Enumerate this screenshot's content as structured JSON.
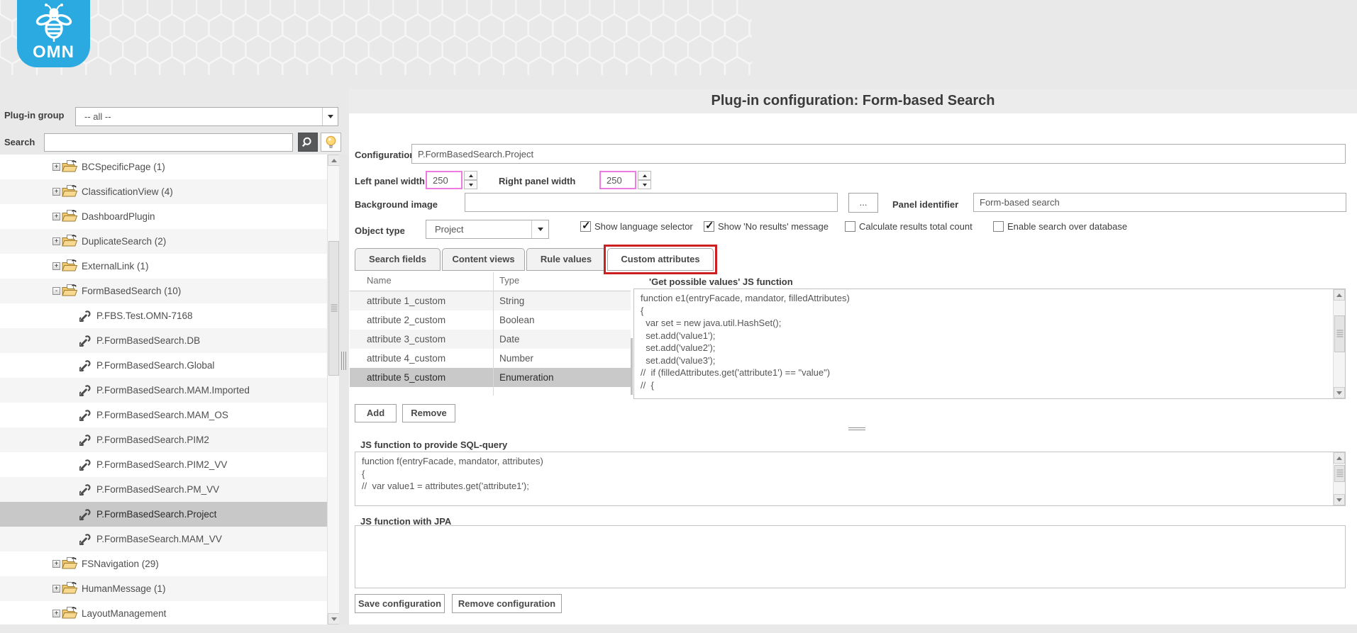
{
  "logo": {
    "text": "OMN"
  },
  "colors": {
    "brand_blue": "#2BA9E1",
    "selection_gray": "#C8C8C8",
    "field_highlight_pink": "#F07BE0",
    "annotation_red": "#CC2020",
    "search_button_gray": "#57585A"
  },
  "icons": {
    "logo": "bee-icon",
    "search_button": "magnifier-icon",
    "hint_button": "lightbulb-icon",
    "tree_group": "open-folder-icon",
    "tree_config": "wrench-icon"
  },
  "sidebar": {
    "plugin_group_label": "Plug-in group",
    "plugin_group_value": "-- all --",
    "search_label": "Search",
    "search_value": "",
    "tree": [
      {
        "label": "BCSpecificPage (1)",
        "kind": "group"
      },
      {
        "label": "ClassificationView (4)",
        "kind": "group"
      },
      {
        "label": "DashboardPlugin",
        "kind": "group"
      },
      {
        "label": "DuplicateSearch (2)",
        "kind": "group"
      },
      {
        "label": "ExternalLink (1)",
        "kind": "group"
      },
      {
        "label": "FormBasedSearch (10)",
        "kind": "group",
        "expanded": true
      },
      {
        "label": "P.FBS.Test.OMN-7168",
        "kind": "config"
      },
      {
        "label": "P.FormBasedSearch.DB",
        "kind": "config"
      },
      {
        "label": "P.FormBasedSearch.Global",
        "kind": "config"
      },
      {
        "label": "P.FormBasedSearch.MAM.Imported",
        "kind": "config"
      },
      {
        "label": "P.FormBasedSearch.MAM_OS",
        "kind": "config"
      },
      {
        "label": "P.FormBasedSearch.PIM2",
        "kind": "config"
      },
      {
        "label": "P.FormBasedSearch.PIM2_VV",
        "kind": "config"
      },
      {
        "label": "P.FormBasedSearch.PM_VV",
        "kind": "config"
      },
      {
        "label": "P.FormBasedSearch.Project",
        "kind": "config",
        "selected": true
      },
      {
        "label": "P.FormBaseSearch.MAM_VV",
        "kind": "config"
      },
      {
        "label": "FSNavigation (29)",
        "kind": "group"
      },
      {
        "label": "HumanMessage (1)",
        "kind": "group"
      },
      {
        "label": "LayoutManagement",
        "kind": "group"
      }
    ]
  },
  "header": {
    "title": "Plug-in configuration: Form-based Search"
  },
  "form": {
    "config_identifier": {
      "label": "Configuration identifier",
      "value": "P.FormBasedSearch.Project"
    },
    "left_panel_width": {
      "label": "Left panel width",
      "value": "250"
    },
    "right_panel_width": {
      "label": "Right panel width",
      "value": "250"
    },
    "background_image": {
      "label": "Background image",
      "value": ""
    },
    "browse_button": "...",
    "panel_identifier": {
      "label": "Panel identifier",
      "value": "Form-based search"
    },
    "object_type": {
      "label": "Object type",
      "value": "Project"
    },
    "checkboxes": [
      {
        "label": "Show language selector",
        "checked": true
      },
      {
        "label": "Show 'No results' message",
        "checked": true
      },
      {
        "label": "Calculate results total count",
        "checked": false
      },
      {
        "label": "Enable search over database",
        "checked": false
      }
    ]
  },
  "tabs": [
    {
      "label": "Search fields"
    },
    {
      "label": "Content views"
    },
    {
      "label": "Rule values"
    },
    {
      "label": "Custom attributes",
      "active": true,
      "annotated": true
    }
  ],
  "attributes_table": {
    "columns": [
      "Name",
      "Type"
    ],
    "rows": [
      {
        "name": "attribute 1_custom",
        "type": "String"
      },
      {
        "name": "attribute 2_custom",
        "type": "Boolean"
      },
      {
        "name": "attribute 3_custom",
        "type": "Date"
      },
      {
        "name": "attribute 4_custom",
        "type": "Number"
      },
      {
        "name": "attribute 5_custom",
        "type": "Enumeration",
        "selected": true
      }
    ]
  },
  "get_values_section": {
    "label": "'Get possible values' JS function",
    "code": "function e1(entryFacade, mandator, filledAttributes)\n{\n  var set = new java.util.HashSet();\n  set.add('value1');\n  set.add('value2');\n  set.add('value3');\n//  if (filledAttributes.get('attribute1') == \"value\")\n//  {"
  },
  "sql_section": {
    "label": "JS function to provide SQL-query",
    "code": "function f(entryFacade, mandator, attributes)\n{\n//  var value1 = attributes.get('attribute1');"
  },
  "jpa_section": {
    "label": "JS function with JPA",
    "code": ""
  },
  "buttons": {
    "add": "Add",
    "remove": "Remove",
    "save": "Save configuration",
    "remove_config": "Remove configuration"
  }
}
